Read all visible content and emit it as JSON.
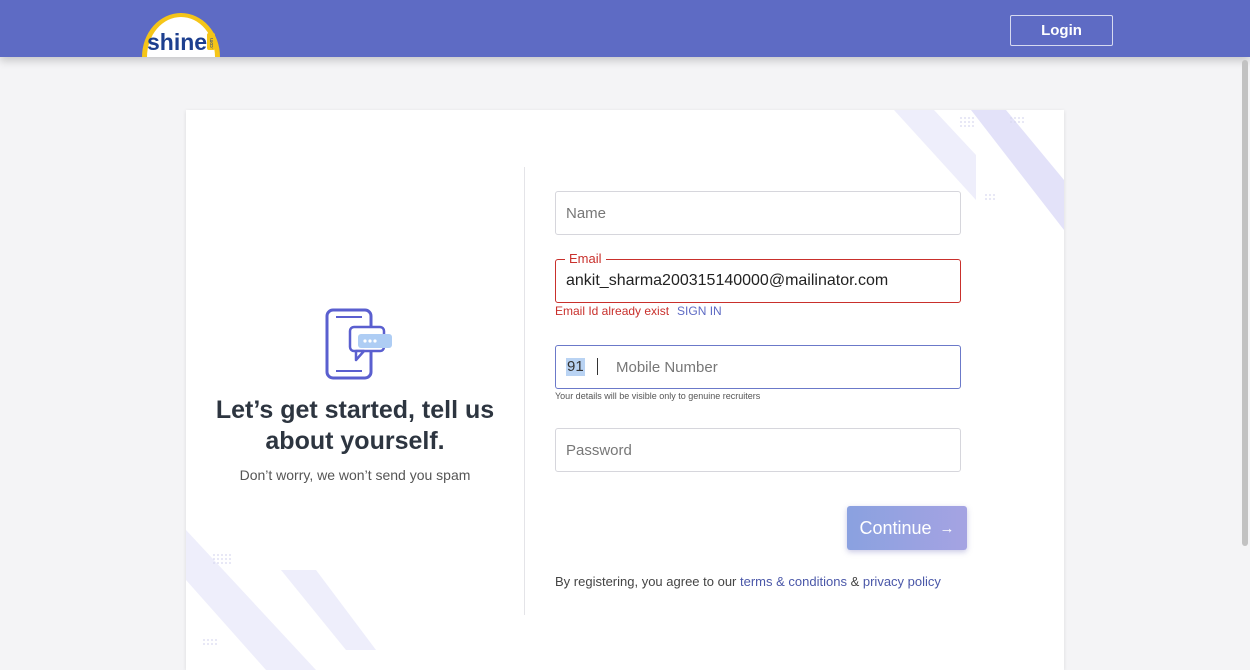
{
  "header": {
    "logo_text": "shine",
    "logo_tld": ".com",
    "login_label": "Login"
  },
  "intro": {
    "headline_line1": "Let’s get started, tell us",
    "headline_line2": "about yourself.",
    "subline": "Don’t worry, we won’t send you spam"
  },
  "form": {
    "name_placeholder": "Name",
    "email_label": "Email",
    "email_value": "ankit_sharma200315140000@mailinator.com",
    "email_error": "Email Id already exist",
    "sign_in_label": "SIGN IN",
    "country_code": "91",
    "mobile_placeholder": "Mobile Number",
    "mobile_hint": "Your details will be visible only to genuine recruiters",
    "password_placeholder": "Password",
    "continue_label": "Continue",
    "continue_arrow": "→"
  },
  "terms": {
    "prefix": "By registering, you agree to our",
    "terms_link": "terms & conditions",
    "amp": "&",
    "privacy_link": "privacy policy"
  },
  "colors": {
    "header_bg": "#5e6bc4",
    "error": "#c9302c",
    "link": "#4a57a8",
    "logo_yellow": "#f5c518"
  }
}
